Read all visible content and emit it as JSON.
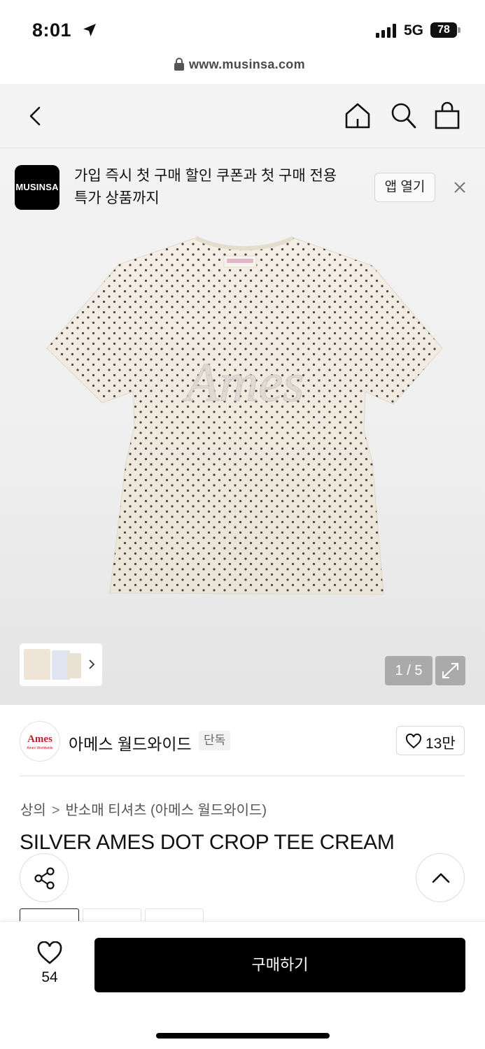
{
  "status_bar": {
    "time": "8:01",
    "network": "5G",
    "battery": "78",
    "icons": [
      "location-arrow-icon",
      "signal-icon",
      "battery-icon"
    ]
  },
  "browser": {
    "url": "www.musinsa.com",
    "icons": [
      "lock-icon"
    ]
  },
  "nav": {
    "icons": [
      "back-icon",
      "home-icon",
      "search-icon",
      "shopping-bag-icon"
    ]
  },
  "promo": {
    "logo_text": "MUSINSA",
    "message_line1": "가입 즉시 첫 구매 할인 쿠폰과 첫 구매 전용",
    "message_line2": "특가 상품까지",
    "open_app_label": "앱 열기",
    "close_icon": "close-icon"
  },
  "gallery": {
    "counter": "1 / 5",
    "product_print_text": "Ames",
    "expand_icon": "expand-icon",
    "thumb_chevron_icon": "chevron-right-icon"
  },
  "brand": {
    "logo_text": "Ames",
    "logo_subtext": "Ames Worldwide",
    "name": "아메스 월드와이드",
    "badge": "단독",
    "likes": "13만"
  },
  "breadcrumb": {
    "category": "상의",
    "subcategory": "반소매 티셔츠 (아메스 월드와이드)"
  },
  "product": {
    "title": "SILVER AMES DOT CROP TEE CREAM"
  },
  "actions": {
    "share_icon": "share-icon",
    "scroll_top_icon": "chevron-up-icon",
    "wish_count": "54",
    "buy_label": "구매하기"
  },
  "colors": {
    "primary_button": "#000000",
    "brand_red": "#c0202b",
    "tee_fabric": "#efe9de"
  }
}
